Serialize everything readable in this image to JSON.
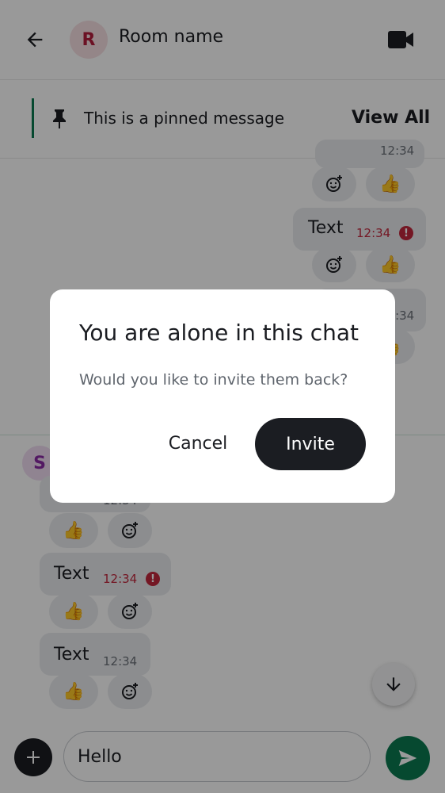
{
  "header": {
    "room_avatar_letter": "R",
    "room_name": "Room name",
    "back_icon": "arrow-left-icon",
    "video_icon": "video-call-icon"
  },
  "pinned": {
    "icon": "pin-icon",
    "text": "This is a pinned message",
    "view_all_label": "View All"
  },
  "timeline": {
    "outgoing": [
      {
        "partial_time": "12:34"
      },
      {
        "text": "Text",
        "time": "12:34",
        "status": "error"
      },
      {
        "partial_time": "12:34"
      }
    ],
    "incoming": {
      "sender_avatar_letter": "S",
      "messages": [
        {
          "partial_time": "12:34"
        },
        {
          "text": "Text",
          "time": "12:34",
          "status": "error"
        },
        {
          "text": "Text",
          "time": "12:34"
        }
      ]
    },
    "reaction_emoji": "👍",
    "error_mark": "!"
  },
  "composer": {
    "value": "Hello",
    "plus_icon": "plus-icon",
    "send_icon": "send-icon"
  },
  "dialog": {
    "title": "You are alone in this chat",
    "subtitle": "Would you like to invite them back?",
    "cancel_label": "Cancel",
    "invite_label": "Invite"
  },
  "colors": {
    "accent_green": "#0b7a50",
    "error_red": "#c2273c",
    "dark": "#1b1d22"
  }
}
